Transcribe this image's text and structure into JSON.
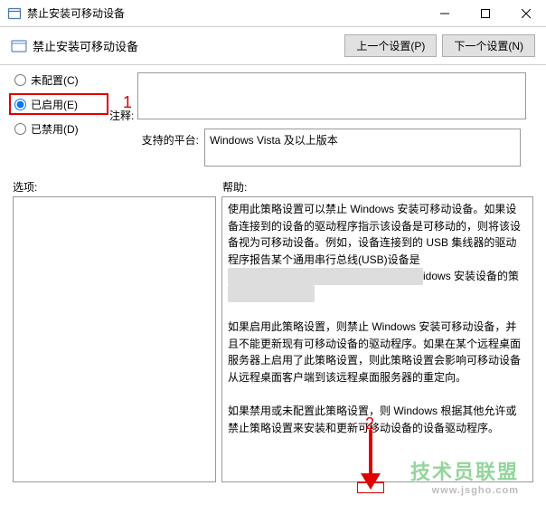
{
  "window": {
    "title": "禁止安装可移动设备",
    "min_tip": "最小化",
    "max_tip": "最大化",
    "close_tip": "关闭"
  },
  "header": {
    "title": "禁止安装可移动设备",
    "prev_btn": "上一个设置(P)",
    "next_btn": "下一个设置(N)"
  },
  "radios": {
    "not_configured": "未配置(C)",
    "enabled": "已启用(E)",
    "disabled": "已禁用(D)",
    "selected": "enabled"
  },
  "comment": {
    "label": "注释:",
    "value": ""
  },
  "platform": {
    "label": "支持的平台:",
    "value": "Windows Vista 及以上版本"
  },
  "columns": {
    "options": "选项:",
    "help": "帮助:"
  },
  "help": {
    "p1a": "使用此策略设置可以禁止 Windows 安装可移动设备。如果设备连接到的设备的驱动程序指示该设备是可移动的，则将该设备视为可移动设备。例如，设备连接到的 USB 集线器的驱动程序报告某个通用串行总线(USB)设备是",
    "p1_ob": "　　　　　　　　　　　　　　　　　　",
    "p1b": "idows 安装设备的策",
    "p1_ob2": "　　　　　　　　",
    "p2": "如果启用此策略设置，则禁止 Windows 安装可移动设备，并且不能更新现有可移动设备的驱动程序。如果在某个远程桌面服务器上启用了此策略设置，则此策略设置会影响可移动设备从远程桌面客户端到该远程桌面服务器的重定向。",
    "p3": "如果禁用或未配置此策略设置，则 Windows 根据其他允许或禁止策略设置来安装和更新可移动设备的设备驱动程序。"
  },
  "annotations": {
    "box1_num": "1",
    "arrow_num": "2"
  },
  "watermark": {
    "main": "技术员联盟",
    "sub": "www.jsgho.com"
  }
}
